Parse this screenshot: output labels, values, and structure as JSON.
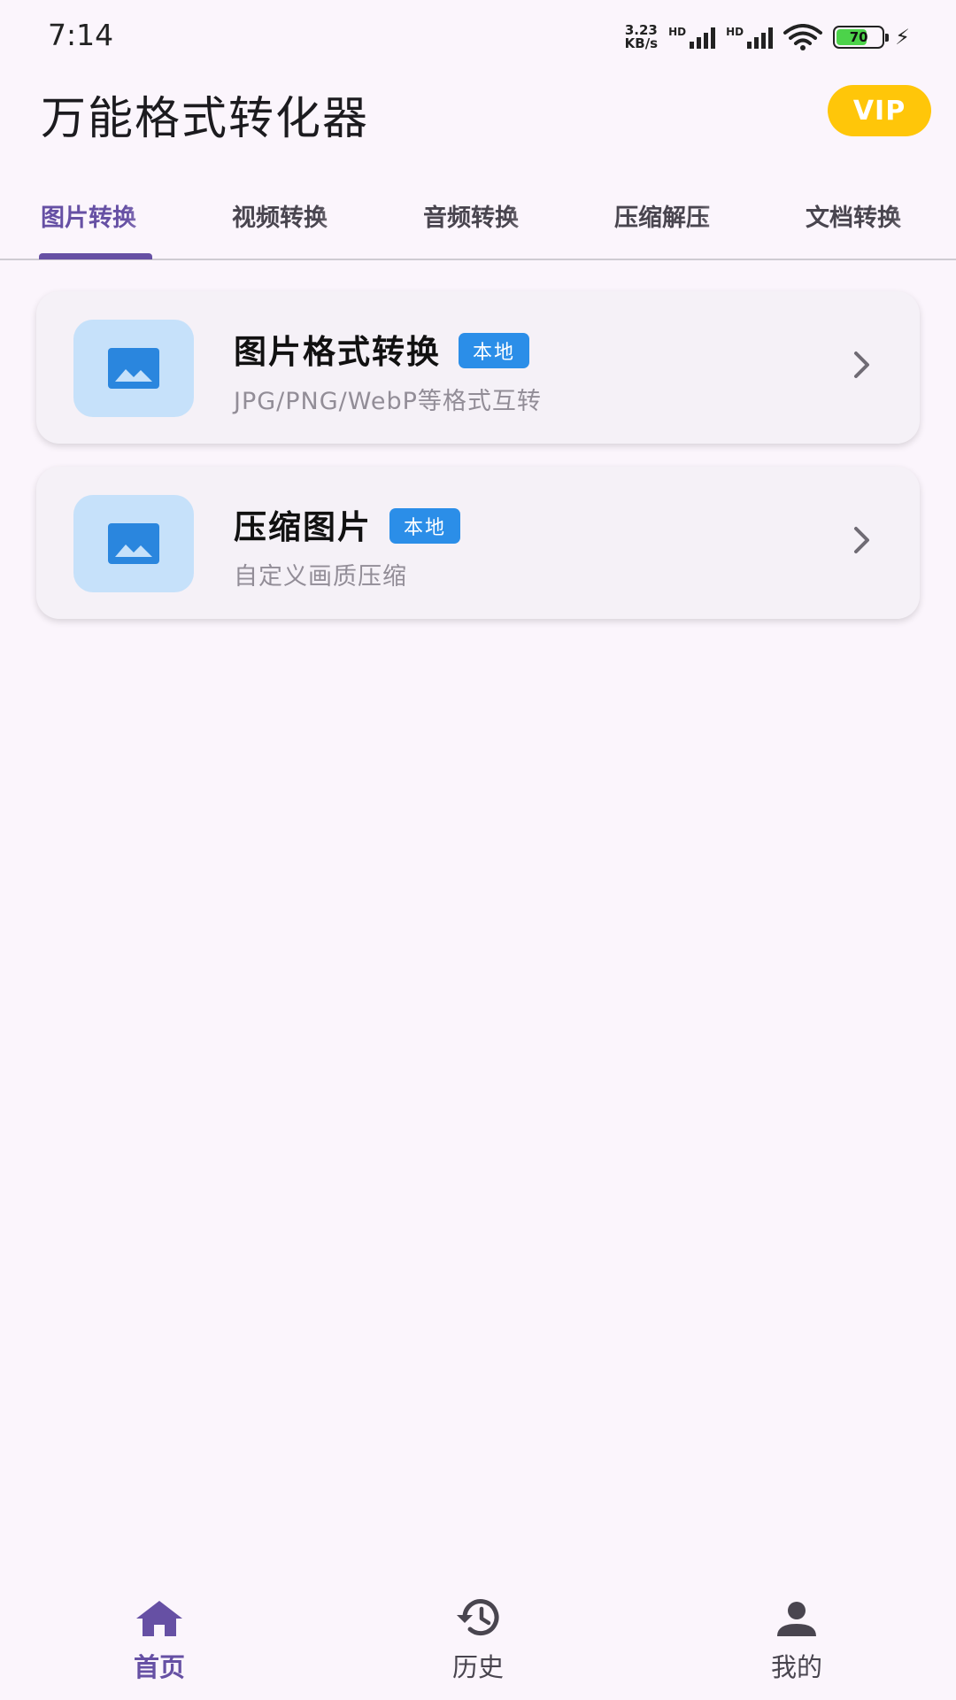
{
  "status_bar": {
    "time": "7:14",
    "net_speed_value": "3.23",
    "net_speed_unit": "KB/s",
    "sim1_label": "HD",
    "sim2_label": "HD",
    "battery_level": "70"
  },
  "header": {
    "title": "万能格式转化器",
    "vip_label": "VIP"
  },
  "tabs": [
    {
      "label": "图片转换"
    },
    {
      "label": "视频转换"
    },
    {
      "label": "音频转换"
    },
    {
      "label": "压缩解压"
    },
    {
      "label": "文档转换"
    }
  ],
  "active_tab": 0,
  "cards": [
    {
      "title": "图片格式转换",
      "badge": "本地",
      "subtitle": "JPG/PNG/WebP等格式互转",
      "icon": "image-icon"
    },
    {
      "title": "压缩图片",
      "badge": "本地",
      "subtitle": "自定义画质压缩",
      "icon": "image-icon"
    }
  ],
  "bottom_nav": [
    {
      "label": "首页",
      "icon": "home-icon"
    },
    {
      "label": "历史",
      "icon": "history-icon"
    },
    {
      "label": "我的",
      "icon": "person-icon"
    }
  ],
  "colors": {
    "accent": "#6650a4",
    "vip": "#ffc609",
    "badge": "#2b8ee8",
    "icon_bg": "#c6e1fa",
    "icon_fg": "#2a86de"
  }
}
